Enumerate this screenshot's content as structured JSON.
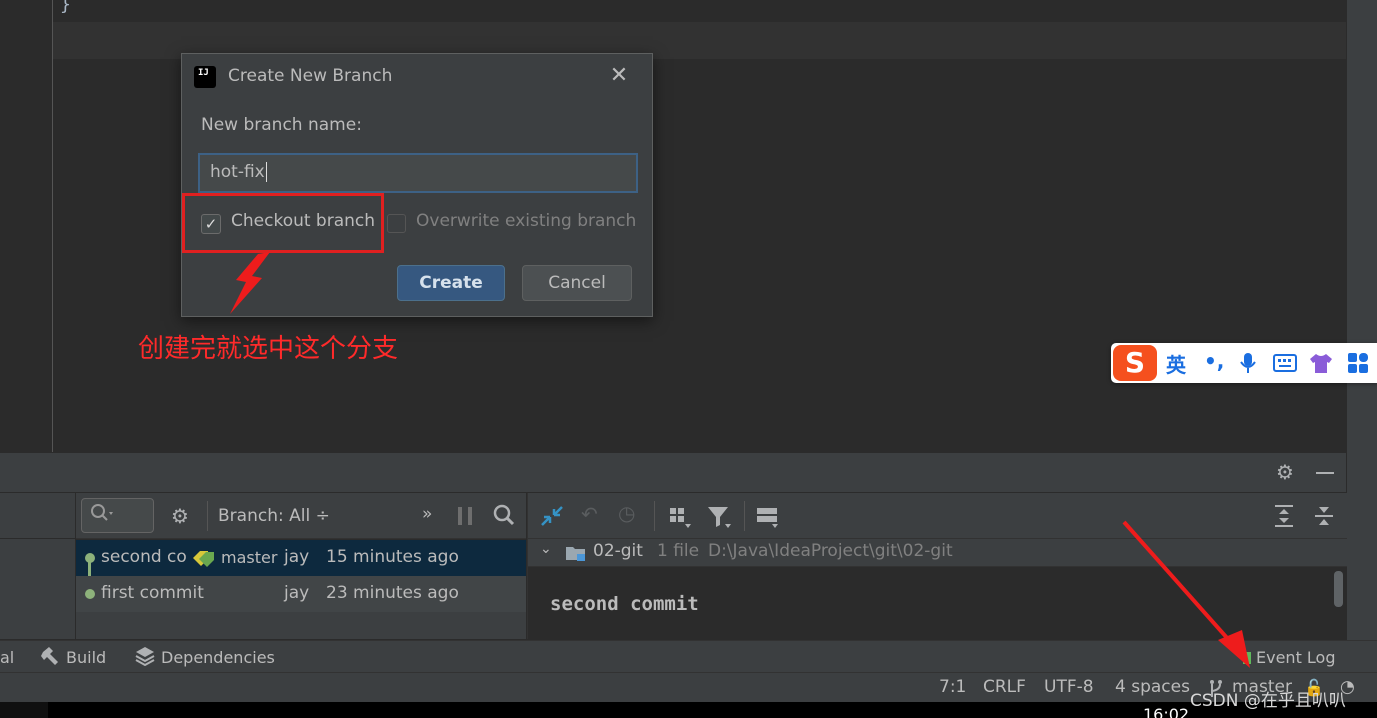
{
  "editor": {
    "brace": "}"
  },
  "dialog": {
    "title": "Create New Branch",
    "logo_text": "IJ",
    "close_glyph": "✕",
    "name_label": "New branch name:",
    "name_value": "hot-fix",
    "checkout_label": "Checkout branch",
    "checkout_checked": true,
    "overwrite_label": "Overwrite existing branch",
    "overwrite_checked": false,
    "create_label": "Create",
    "cancel_label": "Cancel"
  },
  "annotation": {
    "text": "创建完就选中这个分支",
    "color": "#ff2a2a"
  },
  "ime": {
    "logo": "S",
    "items": [
      "英",
      "•,",
      "mic-icon",
      "keyboard-icon",
      "shirt-icon",
      "grid-icon"
    ],
    "lang_label": "英",
    "punct_label": "•,"
  },
  "git_log": {
    "branch_filter": "Branch: All ÷",
    "more": "»",
    "commits": [
      {
        "message": "second co",
        "tag": "master",
        "author": "jay",
        "time": "15 minutes ago",
        "selected": true
      },
      {
        "message": "first commit",
        "tag": "",
        "author": "jay",
        "time": "23 minutes ago",
        "selected": false
      }
    ]
  },
  "details": {
    "folder": "02-git",
    "file_count": "1 file",
    "path": "D:\\Java\\IdeaProject\\git\\02-git",
    "commit_message": "second commit"
  },
  "tool_strip": {
    "left_clip": "al",
    "build": "Build",
    "dependencies": "Dependencies",
    "event_log": "Event Log"
  },
  "status_bar": {
    "position": "7:1",
    "line_sep": "CRLF",
    "encoding": "UTF-8",
    "indent": "4 spaces",
    "branch": "master"
  },
  "watermark": "CSDN @在乎且叭叭",
  "taskbar": {
    "clock": "16:02"
  }
}
